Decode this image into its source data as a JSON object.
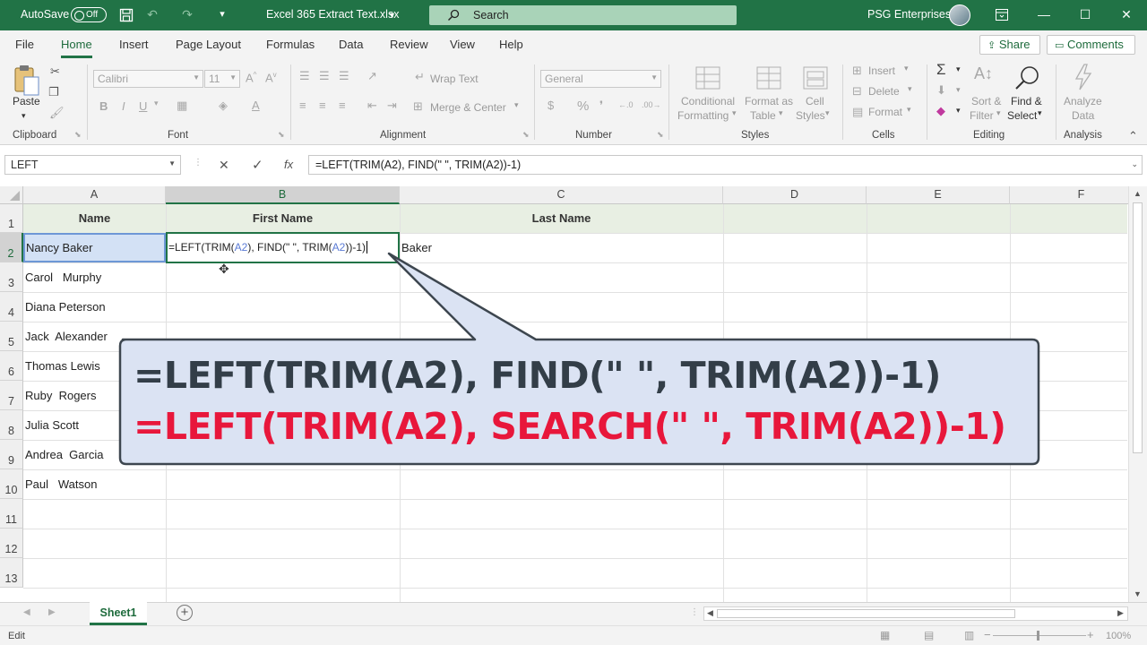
{
  "titlebar": {
    "autosave_label": "AutoSave",
    "autosave_state": "Off",
    "filename": "Excel 365 Extract Text.xlsx",
    "search_placeholder": "Search",
    "account": "PSG Enterprises",
    "accent": "#217346"
  },
  "tabs": [
    "File",
    "Home",
    "Insert",
    "Page Layout",
    "Formulas",
    "Data",
    "Review",
    "View",
    "Help"
  ],
  "active_tab": "Home",
  "share_label": "Share",
  "comments_label": "Comments",
  "ribbon": {
    "clipboard": {
      "paste": "Paste",
      "label": "Clipboard"
    },
    "font": {
      "name": "Calibri",
      "size": "11",
      "label": "Font",
      "bold": "B",
      "italic": "I",
      "underline": "U"
    },
    "alignment": {
      "wrap": "Wrap Text",
      "merge": "Merge & Center",
      "label": "Alignment"
    },
    "number": {
      "format": "General",
      "label": "Number",
      "currency": "$",
      "percent": "%"
    },
    "styles": {
      "conditional_1": "Conditional",
      "conditional_2": "Formatting",
      "table_1": "Format as",
      "table_2": "Table",
      "cell_1": "Cell",
      "cell_2": "Styles",
      "label": "Styles"
    },
    "cells": {
      "insert": "Insert",
      "delete": "Delete",
      "format": "Format",
      "label": "Cells"
    },
    "editing": {
      "sum": "Σ",
      "sort_1": "Sort &",
      "sort_2": "Filter",
      "find_1": "Find &",
      "find_2": "Select",
      "label": "Editing"
    },
    "analysis": {
      "analyze_1": "Analyze",
      "analyze_2": "Data",
      "label": "Analysis"
    }
  },
  "formula_bar": {
    "name_box": "LEFT",
    "cancel": "✕",
    "enter": "✓",
    "fx": "fx",
    "formula": "=LEFT(TRIM(A2), FIND(\" \", TRIM(A2))-1)"
  },
  "columns": [
    "A",
    "B",
    "C",
    "D",
    "E",
    "F"
  ],
  "rows": [
    "1",
    "2",
    "3",
    "4",
    "5",
    "6",
    "7",
    "8",
    "9",
    "10",
    "11",
    "12",
    "13"
  ],
  "headers": {
    "name": "Name",
    "first": "First Name",
    "last": "Last Name"
  },
  "names": [
    "Nancy Baker",
    "Carol   Murphy",
    "Diana Peterson",
    "Jack  Alexander",
    "Thomas Lewis",
    "Ruby  Rogers",
    "Julia Scott",
    "Andrea  Garcia",
    "Paul   Watson"
  ],
  "b2_edit": {
    "p1": "=LEFT(TRIM(",
    "r1": "A2",
    "p2": "), FIND(\" \", TRIM(",
    "r2": "A2",
    "p3": "))-1)"
  },
  "c2_value": "Baker",
  "callout": {
    "line1": "=LEFT(TRIM(A2), FIND(\" \", TRIM(A2))-1)",
    "line2": "=LEFT(TRIM(A2), SEARCH(\" \", TRIM(A2))-1)",
    "line2_color": "#e8173b",
    "fill": "#dbe3f3"
  },
  "sheet_tab": "Sheet1",
  "status": {
    "mode": "Edit",
    "zoom": "100%"
  }
}
